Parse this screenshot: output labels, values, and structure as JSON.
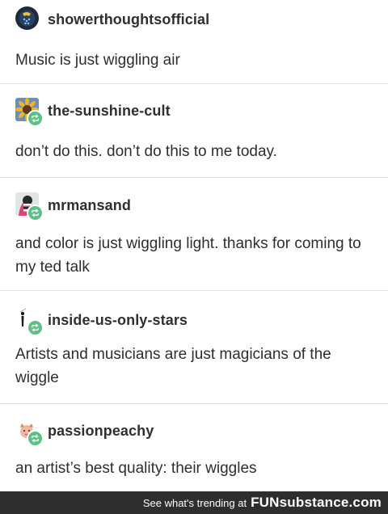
{
  "posts": [
    {
      "username": "showerthoughtsofficial",
      "text": "Music is just wiggling air",
      "avatar_icon": "shower-avatar",
      "reblog": false
    },
    {
      "username": "the-sunshine-cult",
      "text": "don’t do this. don’t do this to me today.",
      "avatar_icon": "sunflower-avatar",
      "reblog": true
    },
    {
      "username": "mrmansand",
      "text": "and color is just wiggling light. thanks for coming to my ted talk",
      "avatar_icon": "character-avatar",
      "reblog": true
    },
    {
      "username": "inside-us-only-stars",
      "text": "Artists and musicians are just magicians of the wiggle",
      "avatar_icon": "figure-avatar",
      "reblog": true
    },
    {
      "username": "passionpeachy",
      "text": "an artist’s best quality: their wiggles",
      "avatar_icon": "peach-avatar",
      "reblog": true
    }
  ],
  "footer": {
    "text": "See what's trending at",
    "brand_fun": "FUN",
    "brand_sub": "substance.com"
  },
  "colors": {
    "reblog_badge": "#5fbf86",
    "footer_bg": "#2e2e2e",
    "divider": "#e2e2e2"
  }
}
